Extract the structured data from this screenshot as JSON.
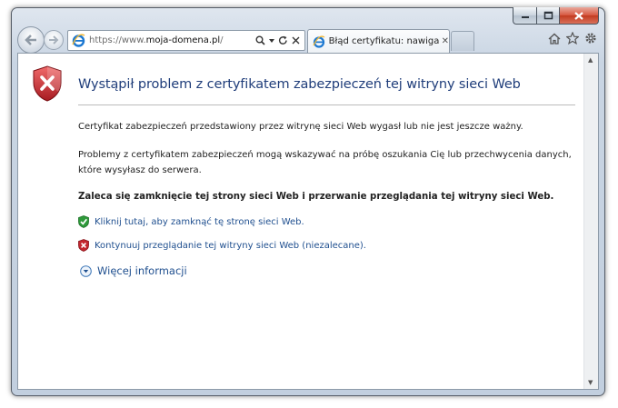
{
  "toolbar": {
    "url_prefix": "https://www.",
    "url_domain": "moja-domena.pl",
    "url_suffix": "/"
  },
  "tab": {
    "title": "Błąd certyfikatu: nawigacja ...",
    "close": "✕"
  },
  "page": {
    "title": "Wystąpił problem z certyfikatem zabezpieczeń tej witryny sieci Web",
    "p1": "Certyfikat zabezpieczeń przedstawiony przez witrynę sieci Web wygasł lub nie jest jeszcze ważny.",
    "p2_line1": "Problemy z certyfikatem zabezpieczeń mogą wskazywać na próbę oszukania Cię lub przechwycenia danych,",
    "p2_line2": "które wysyłasz do serwera.",
    "recommendation": "Zaleca się zamknięcie tej strony sieci Web i przerwanie przeglądania tej witryny sieci Web.",
    "close_link": "Kliknij tutaj, aby zamknąć tę stronę sieci Web.",
    "continue_link": "Kontynuuj przeglądanie tej witryny sieci Web (niezalecane).",
    "more_info": "Więcej informacji"
  },
  "colors": {
    "title": "#1f3d7a",
    "link": "#1f4f8f",
    "shield_red": "#c4262e",
    "shield_green": "#2e9a3a"
  },
  "icons": {
    "shield_large": "error-shield-icon",
    "shield_ok": "green-shield-icon",
    "shield_error": "red-shield-icon",
    "expand": "chevron-down-circle-icon"
  }
}
